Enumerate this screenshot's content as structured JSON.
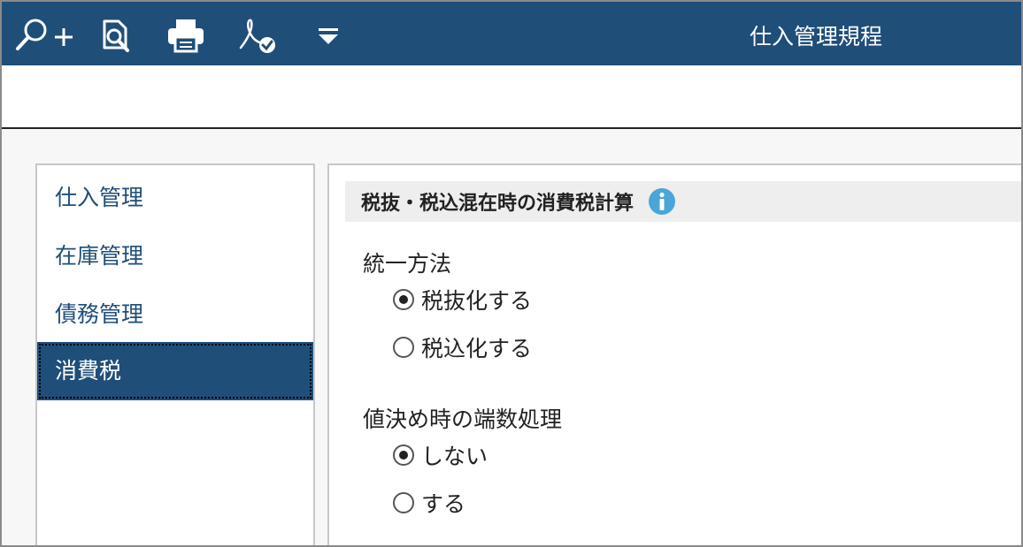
{
  "header": {
    "title": "仕入管理規程",
    "tools": [
      {
        "icon": "zoom-in-icon"
      },
      {
        "icon": "find-icon"
      },
      {
        "icon": "printer-icon"
      },
      {
        "icon": "pdf-check-icon"
      },
      {
        "icon": "dropdown-triangle-icon"
      }
    ]
  },
  "sidebar": {
    "items": [
      {
        "label": "仕入管理",
        "active": false
      },
      {
        "label": "在庫管理",
        "active": false
      },
      {
        "label": "債務管理",
        "active": false
      },
      {
        "label": "消費税",
        "active": true
      }
    ]
  },
  "main": {
    "section_title": "税抜・税込混在時の消費税計算",
    "info_icon": "info-icon",
    "groups": [
      {
        "label": "統一方法",
        "options": [
          {
            "label": "税抜化する",
            "checked": true
          },
          {
            "label": "税込化する",
            "checked": false
          }
        ]
      },
      {
        "label": "値決め時の端数処理",
        "options": [
          {
            "label": "しない",
            "checked": true
          },
          {
            "label": "する",
            "checked": false
          }
        ]
      }
    ]
  },
  "colors": {
    "brand": "#1f4e79",
    "info": "#4aa6d6",
    "section_bg": "#eeeeee"
  }
}
